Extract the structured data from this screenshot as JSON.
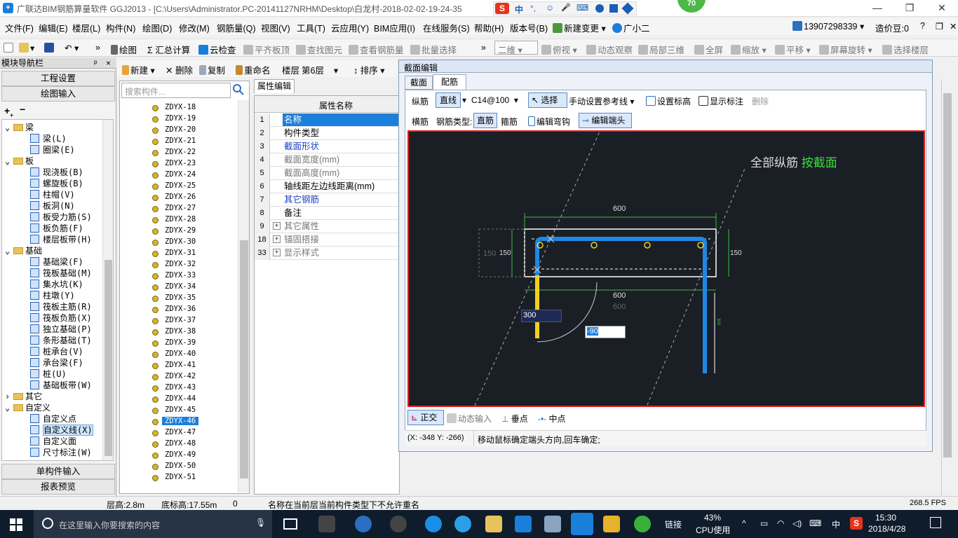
{
  "window": {
    "title": "广联达BIM钢筋算量软件 GGJ2013 - [C:\\Users\\Administrator.PC-20141127NRHM\\Desktop\\白龙村-2018-02-02-19-24-35",
    "badge": "70",
    "ime_icons": [
      "中",
      "°,",
      "☺",
      "🎤",
      "⌨"
    ]
  },
  "menu": {
    "items": [
      "文件(F)",
      "编辑(E)",
      "楼层(L)",
      "构件(N)",
      "绘图(D)",
      "修改(M)",
      "钢筋量(Q)",
      "视图(V)",
      "工具(T)",
      "云应用(Y)",
      "BIM应用(I)",
      "在线服务(S)",
      "帮助(H)",
      "版本号(B)",
      "新建变更",
      "广小二"
    ],
    "phone": "13907298339",
    "price": "造价豆:0"
  },
  "toolbar": {
    "items": [
      "绘图",
      "汇总计算",
      "云检查",
      "平齐板顶",
      "查找图元",
      "查看钢筋量",
      "批量选择",
      "二维",
      "俯视",
      "动态观察",
      "局部三维",
      "全屏",
      "缩放",
      "平移",
      "屏幕旋转",
      "选择楼层"
    ]
  },
  "nav": {
    "header": "模块导航栏",
    "pin": "ᵖ",
    "close": "×",
    "btn_project": "工程设置",
    "btn_draw": "绘图输入",
    "btn_single": "单构件输入",
    "btn_report": "报表预览",
    "tree": [
      {
        "label": "梁",
        "level": 0,
        "folder": true,
        "sign": "⌄"
      },
      {
        "label": "梁(L)",
        "level": 1
      },
      {
        "label": "圈梁(E)",
        "level": 1
      },
      {
        "label": "板",
        "level": 0,
        "folder": true,
        "sign": "⌄"
      },
      {
        "label": "现浇板(B)",
        "level": 1
      },
      {
        "label": "螺旋板(B)",
        "level": 1
      },
      {
        "label": "柱帽(V)",
        "level": 1
      },
      {
        "label": "板洞(N)",
        "level": 1
      },
      {
        "label": "板受力筋(S)",
        "level": 1
      },
      {
        "label": "板负筋(F)",
        "level": 1
      },
      {
        "label": "楼层板带(H)",
        "level": 1
      },
      {
        "label": "基础",
        "level": 0,
        "folder": true,
        "sign": "⌄"
      },
      {
        "label": "基础梁(F)",
        "level": 1
      },
      {
        "label": "筏板基础(M)",
        "level": 1
      },
      {
        "label": "集水坑(K)",
        "level": 1
      },
      {
        "label": "柱墩(Y)",
        "level": 1
      },
      {
        "label": "筏板主筋(R)",
        "level": 1
      },
      {
        "label": "筏板负筋(X)",
        "level": 1
      },
      {
        "label": "独立基础(P)",
        "level": 1
      },
      {
        "label": "条形基础(T)",
        "level": 1
      },
      {
        "label": "桩承台(V)",
        "level": 1
      },
      {
        "label": "承台梁(F)",
        "level": 1
      },
      {
        "label": "桩(U)",
        "level": 1
      },
      {
        "label": "基础板带(W)",
        "level": 1
      },
      {
        "label": "其它",
        "level": 0,
        "folder": true,
        "sign": "›"
      },
      {
        "label": "自定义",
        "level": 0,
        "folder": true,
        "sign": "⌄"
      },
      {
        "label": "自定义点",
        "level": 1
      },
      {
        "label": "自定义线(X)",
        "level": 1,
        "selected": true
      },
      {
        "label": "自定义面",
        "level": 1
      },
      {
        "label": "尺寸标注(W)",
        "level": 1
      }
    ]
  },
  "list": {
    "search_placeholder": "搜索构件...",
    "items": [
      "ZDYX-18",
      "ZDYX-19",
      "ZDYX-20",
      "ZDYX-21",
      "ZDYX-22",
      "ZDYX-23",
      "ZDYX-24",
      "ZDYX-25",
      "ZDYX-26",
      "ZDYX-27",
      "ZDYX-28",
      "ZDYX-29",
      "ZDYX-30",
      "ZDYX-31",
      "ZDYX-32",
      "ZDYX-33",
      "ZDYX-34",
      "ZDYX-35",
      "ZDYX-36",
      "ZDYX-37",
      "ZDYX-38",
      "ZDYX-39",
      "ZDYX-40",
      "ZDYX-41",
      "ZDYX-42",
      "ZDYX-43",
      "ZDYX-44",
      "ZDYX-45",
      "ZDYX-46",
      "ZDYX-47",
      "ZDYX-48",
      "ZDYX-49",
      "ZDYX-50",
      "ZDYX-51"
    ],
    "selected": "ZDYX-46"
  },
  "midtoolbar": {
    "new": "新建",
    "delete": "删除",
    "copy": "复制",
    "rename": "重命名",
    "floor_label": "楼层",
    "floor_value": "第6层",
    "sort": "排序"
  },
  "props": {
    "tab": "属性编辑",
    "header": "属性名称",
    "rows": [
      {
        "num": "1",
        "name": "名称",
        "selected": true
      },
      {
        "num": "2",
        "name": "构件类型"
      },
      {
        "num": "3",
        "name": "截面形状",
        "blue": true
      },
      {
        "num": "4",
        "name": "截面宽度(mm)",
        "gray": true
      },
      {
        "num": "5",
        "name": "截面高度(mm)",
        "gray": true
      },
      {
        "num": "6",
        "name": "轴线距左边线距离(mm)"
      },
      {
        "num": "7",
        "name": "其它钢筋",
        "blue": true
      },
      {
        "num": "8",
        "name": "备注"
      },
      {
        "num": "9",
        "name": "其它属性",
        "gray": true,
        "plus": true
      },
      {
        "num": "18",
        "name": "锚固搭接",
        "gray": true,
        "plus": true
      },
      {
        "num": "33",
        "name": "显示样式",
        "gray": true,
        "plus": true
      }
    ]
  },
  "dialog": {
    "title": "截面编辑",
    "tabs": [
      "截面",
      "配筋"
    ],
    "row1": {
      "label": "纵筋",
      "mode": "直线",
      "spec": "C14@100",
      "select": "选择",
      "refline": "手动设置参考线",
      "set_elev": "设置标高",
      "show_label": "显示标注",
      "delete": "删除"
    },
    "row2": {
      "label": "横筋",
      "type_label": "钢筋类型:",
      "straight": "直筋",
      "stirrup": "箍筋",
      "edit_hook": "编辑弯钩",
      "edit_end": "编辑端头"
    },
    "canvas": {
      "caption_white": "全部纵筋",
      "caption_green": "按截面",
      "dim_top": "600",
      "dim_bottom": "600",
      "dim_bottom_ghost": "600",
      "dim_left_ghost": "150",
      "dim_left": "150",
      "dim_right": "150",
      "input_len": "300",
      "input_angle": "-90",
      "vert_dim": "300"
    },
    "bottom": {
      "ortho": "正交",
      "dynamic": "动态输入",
      "perp": "垂点",
      "mid": "中点"
    },
    "status": {
      "coords": "(X: -348 Y: -266)",
      "message": "移动鼠标确定端头方向,回车确定;"
    }
  },
  "statusbar": {
    "floor_h": "层高:2.8m",
    "base_h": "底标高:17.55m",
    "zero": "0",
    "message": "名称在当前层当前构件类型下不允许重名",
    "fps": "268.5 FPS"
  },
  "taskbar": {
    "search": "在这里输入你要搜索的内容",
    "link": "链接",
    "cpu_pct": "43%",
    "cpu_label": "CPU使用",
    "ime": "中",
    "time": "15:30",
    "date": "2018/4/28",
    "ime_s": "S",
    "up": "^"
  },
  "colors": {
    "selection": "#1b7fdc",
    "canvas_bg": "#1a1e25",
    "rebar": "#1e88e5",
    "dim_green": "#3fbf3f",
    "border_red": "#e02020",
    "taskbar": "#0f1c2c"
  }
}
